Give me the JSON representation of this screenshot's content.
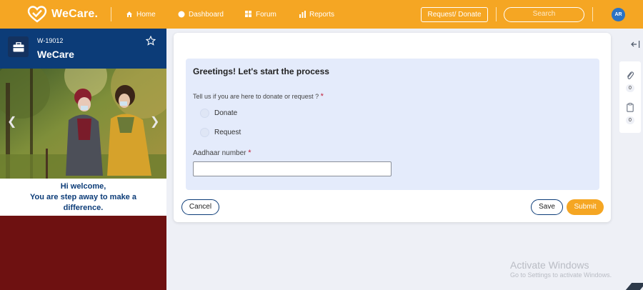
{
  "app": {
    "brand": "WeCare."
  },
  "nav": [
    {
      "label": "Home",
      "icon": "home-icon"
    },
    {
      "label": "Dashboard",
      "icon": "dashboard-icon"
    },
    {
      "label": "Forum",
      "icon": "forum-icon"
    },
    {
      "label": "Reports",
      "icon": "reports-icon"
    }
  ],
  "header": {
    "request_button": "Request/ Donate",
    "search_placeholder": "Search",
    "avatar_initials": "AR"
  },
  "sidebar": {
    "record_id": "W-19012",
    "record_name": "WeCare",
    "welcome_line1": "Hi welcome,",
    "welcome_line2": "You are step away to make a",
    "welcome_line3": "difference."
  },
  "form": {
    "title": "Greetings! Let's start the process",
    "question": "Tell us if you are here to donate or request ?",
    "required_mark": "*",
    "options": [
      "Donate",
      "Request"
    ],
    "aadhaar_label": "Aadhaar number",
    "aadhaar_value": "",
    "cancel": "Cancel",
    "save": "Save",
    "submit": "Submit"
  },
  "rail": {
    "attachments_count": "0",
    "notes_count": "0"
  },
  "watermark": {
    "line1": "Activate Windows",
    "line2": "Go to Settings to activate Windows."
  },
  "colors": {
    "accent": "#f5a623",
    "navy": "#0c3c78",
    "maroon": "#6e1111",
    "form_bg": "#e4ebfb"
  }
}
